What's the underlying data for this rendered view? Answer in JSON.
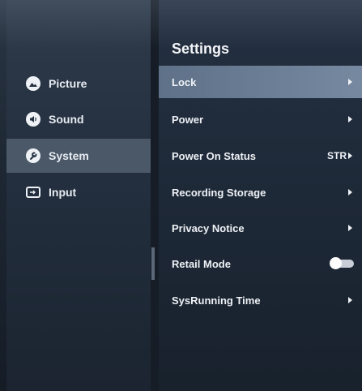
{
  "menu": {
    "items": [
      {
        "label": "Picture",
        "icon": "picture-icon",
        "selected": false
      },
      {
        "label": "Sound",
        "icon": "speaker-icon",
        "selected": false
      },
      {
        "label": "System",
        "icon": "wrench-icon",
        "selected": true
      },
      {
        "label": "Input",
        "icon": "input-icon",
        "selected": false
      }
    ]
  },
  "settings": {
    "title": "Settings",
    "rows": [
      {
        "label": "Lock",
        "value": "",
        "control": "arrow",
        "selected": true
      },
      {
        "label": "Power",
        "value": "",
        "control": "arrow",
        "selected": false
      },
      {
        "label": "Power On Status",
        "value": "STR",
        "control": "arrow",
        "selected": false
      },
      {
        "label": "Recording Storage",
        "value": "",
        "control": "arrow",
        "selected": false
      },
      {
        "label": "Privacy Notice",
        "value": "",
        "control": "arrow",
        "selected": false
      },
      {
        "label": "Retail Mode",
        "value": "",
        "control": "toggle",
        "toggle_on": false,
        "selected": false
      },
      {
        "label": "SysRunning Time",
        "value": "",
        "control": "arrow",
        "selected": false
      }
    ]
  },
  "colors": {
    "selected_left": "#4a5868",
    "selected_right": "#6b7d94",
    "text": "#eef1f5"
  }
}
